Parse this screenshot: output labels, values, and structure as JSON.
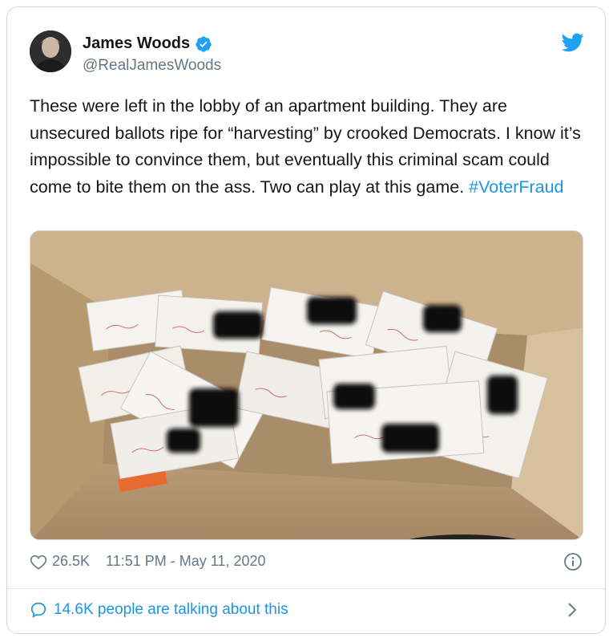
{
  "tweet": {
    "author_name": "James Woods",
    "handle": "@RealJamesWoods",
    "text": "These were left in the lobby of an apartment building. They are unsecured ballots ripe for “harvesting” by crooked Democrats. I know it’s impossible to convince them, but eventually this criminal scam could come to bite them on the ass. Two can play at this game. ",
    "hashtag": "#VoterFraud",
    "likes": "26.5K",
    "timestamp": "11:51 PM - May 11, 2020",
    "talking": "14.6K people are talking about this"
  },
  "colors": {
    "accent": "#1b95e0",
    "twitter_blue": "#1da1f2",
    "secondary_text": "#657786",
    "border": "#cfd9de"
  },
  "icons": {
    "verified": "verified-badge-icon",
    "brand": "twitter-bird-icon",
    "like": "heart-icon",
    "info": "info-icon",
    "comment": "speech-bubble-icon",
    "chevron": "chevron-right-icon"
  }
}
